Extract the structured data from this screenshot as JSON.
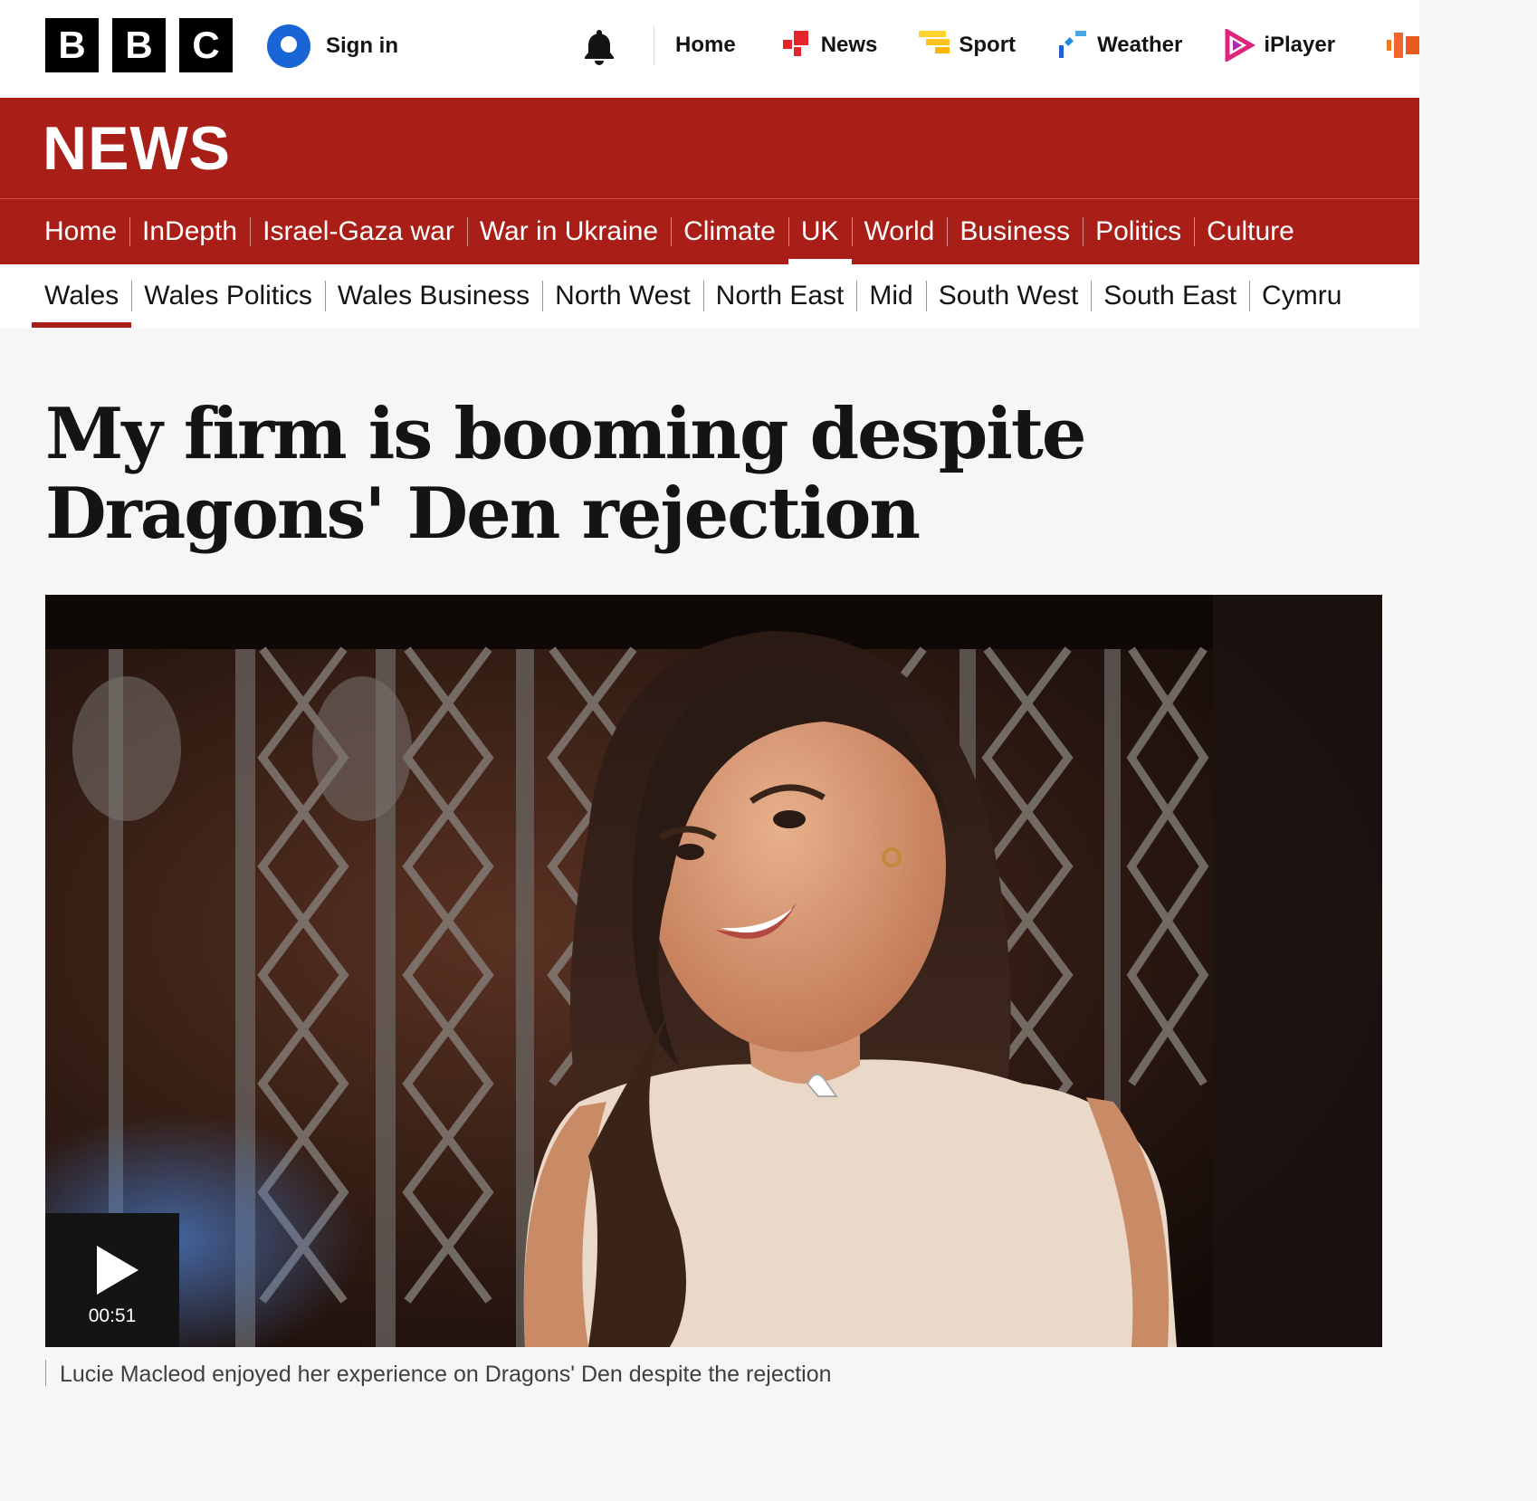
{
  "masthead": {
    "logo_letters": [
      "B",
      "B",
      "C"
    ],
    "sign_in_label": "Sign in",
    "notifications_icon": "bell-icon",
    "nav": [
      {
        "label": "Home",
        "icon": ""
      },
      {
        "label": "News",
        "icon": "news-icon",
        "color": "#e4232b"
      },
      {
        "label": "Sport",
        "icon": "sport-icon",
        "color": "#ffd230"
      },
      {
        "label": "Weather",
        "icon": "weather-icon",
        "color": "#1f8ee0"
      },
      {
        "label": "iPlayer",
        "icon": "iplayer-icon",
        "color": "#e0247b"
      }
    ]
  },
  "banner": {
    "title": "NEWS",
    "color": "#a91f18"
  },
  "section_nav": [
    {
      "label": "Home"
    },
    {
      "label": "InDepth"
    },
    {
      "label": "Israel-Gaza war"
    },
    {
      "label": "War in Ukraine"
    },
    {
      "label": "Climate"
    },
    {
      "label": "UK",
      "active": true
    },
    {
      "label": "World"
    },
    {
      "label": "Business"
    },
    {
      "label": "Politics"
    },
    {
      "label": "Culture"
    }
  ],
  "sub_nav": [
    {
      "label": "Wales",
      "active": true
    },
    {
      "label": "Wales Politics"
    },
    {
      "label": "Wales Business"
    },
    {
      "label": "North West"
    },
    {
      "label": "North East"
    },
    {
      "label": "Mid"
    },
    {
      "label": "South West"
    },
    {
      "label": "South East"
    },
    {
      "label": "Cymru"
    }
  ],
  "article": {
    "headline": "My firm is booming despite Dragons' Den rejection",
    "video": {
      "duration": "00:51",
      "play_icon": "play-icon"
    },
    "caption": "Lucie Macleod enjoyed her experience on Dragons' Den despite the rejection"
  }
}
